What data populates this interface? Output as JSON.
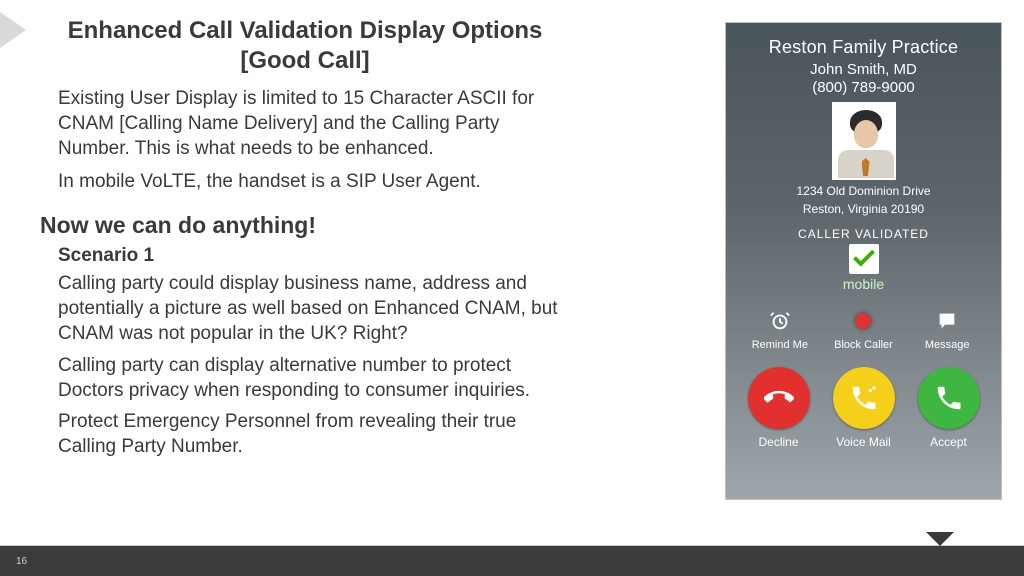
{
  "slide": {
    "title": "Enhanced Call Validation Display Options [Good Call]",
    "para1": "Existing User Display is limited to 15 Character ASCII for CNAM [Calling Name Delivery] and the Calling Party Number. This is what needs to be enhanced.",
    "para2": "In mobile VoLTE, the handset is a SIP User Agent.",
    "heading2": "Now we can do anything!",
    "scenario_label": "Scenario 1",
    "para3": "Calling party could display business name, address and potentially a picture as well based on Enhanced CNAM, but CNAM was not popular in the UK? Right?",
    "para4": "Calling party can display alternative number to protect Doctors privacy when responding to consumer inquiries.",
    "para5": "Protect Emergency Personnel from revealing their true Calling Party Number.",
    "page_number": "16"
  },
  "phone": {
    "business": "Reston Family Practice",
    "caller_name": "John Smith, MD",
    "caller_number": "(800) 789-9000",
    "address_line1": "1234 Old Dominion Drive",
    "address_line2": "Reston, Virginia 20190",
    "validated_label": "CALLER VALIDATED",
    "mobile_label": "mobile",
    "actions_small": {
      "remind": "Remind Me",
      "block": "Block Caller",
      "message": "Message"
    },
    "actions_big": {
      "decline": "Decline",
      "voicemail": "Voice Mail",
      "accept": "Accept"
    }
  }
}
